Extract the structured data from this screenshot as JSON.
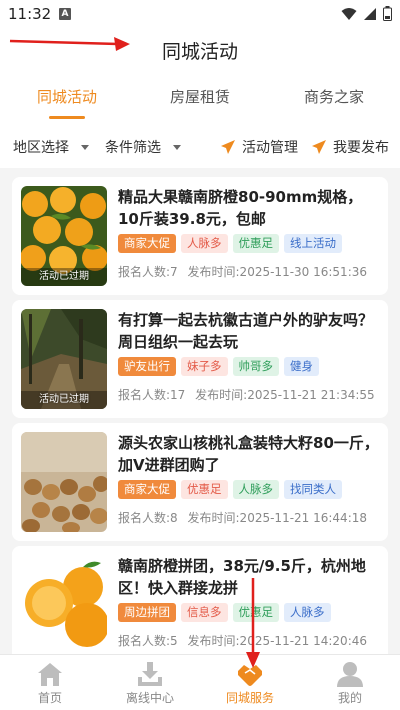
{
  "status_bar": {
    "time": "11:32",
    "notification_letter": "A"
  },
  "header": {
    "title": "同城活动"
  },
  "tabs": [
    {
      "label": "同城活动",
      "active": true
    },
    {
      "label": "房屋租赁",
      "active": false
    },
    {
      "label": "商务之家",
      "active": false
    }
  ],
  "filters": {
    "region": "地区选择",
    "conditions": "条件筛选",
    "manage": "活动管理",
    "publish": "我要发布"
  },
  "accent_color": "#ee8a1f",
  "cards": [
    {
      "title": "精品大果赣南脐橙80-90mm规格，10斤装39.8元，包邮",
      "thumb_label": "活动已过期",
      "tags": [
        {
          "text": "商家大促",
          "style": "orange"
        },
        {
          "text": "人脉多",
          "style": "pink"
        },
        {
          "text": "优惠足",
          "style": "green"
        },
        {
          "text": "线上活动",
          "style": "blue"
        }
      ],
      "signups": "报名人数:7",
      "published": "发布时间:2025-11-30 16:51:36"
    },
    {
      "title": "有打算一起去杭徽古道户外的驴友吗？周日组织一起去玩",
      "thumb_label": "活动已过期",
      "tags": [
        {
          "text": "驴友出行",
          "style": "orange"
        },
        {
          "text": "妹子多",
          "style": "pink"
        },
        {
          "text": "帅哥多",
          "style": "green"
        },
        {
          "text": "健身",
          "style": "blue"
        }
      ],
      "signups": "报名人数:17",
      "published": "发布时间:2025-11-21 21:34:55"
    },
    {
      "title": "源头农家山核桃礼盒装特大籽80一斤，加V进群团购了",
      "thumb_label": "",
      "tags": [
        {
          "text": "商家大促",
          "style": "orange"
        },
        {
          "text": "优惠足",
          "style": "pink"
        },
        {
          "text": "人脉多",
          "style": "green"
        },
        {
          "text": "找同类人",
          "style": "blue"
        }
      ],
      "signups": "报名人数:8",
      "published": "发布时间:2025-11-21 16:44:18"
    },
    {
      "title": "赣南脐橙拼团，38元/9.5斤，杭州地区！快入群接龙拼",
      "thumb_label": "",
      "tags": [
        {
          "text": "周边拼团",
          "style": "orange"
        },
        {
          "text": "信息多",
          "style": "pink"
        },
        {
          "text": "优惠足",
          "style": "green"
        },
        {
          "text": "人脉多",
          "style": "blue"
        }
      ],
      "signups": "报名人数:5",
      "published": "发布时间:2025-11-21 14:20:46"
    }
  ],
  "bottom_nav": [
    {
      "label": "首页",
      "icon": "home-icon",
      "active": false
    },
    {
      "label": "离线中心",
      "icon": "download-icon",
      "active": false
    },
    {
      "label": "同城服务",
      "icon": "handshake-icon",
      "active": true
    },
    {
      "label": "我的",
      "icon": "person-icon",
      "active": false
    }
  ]
}
